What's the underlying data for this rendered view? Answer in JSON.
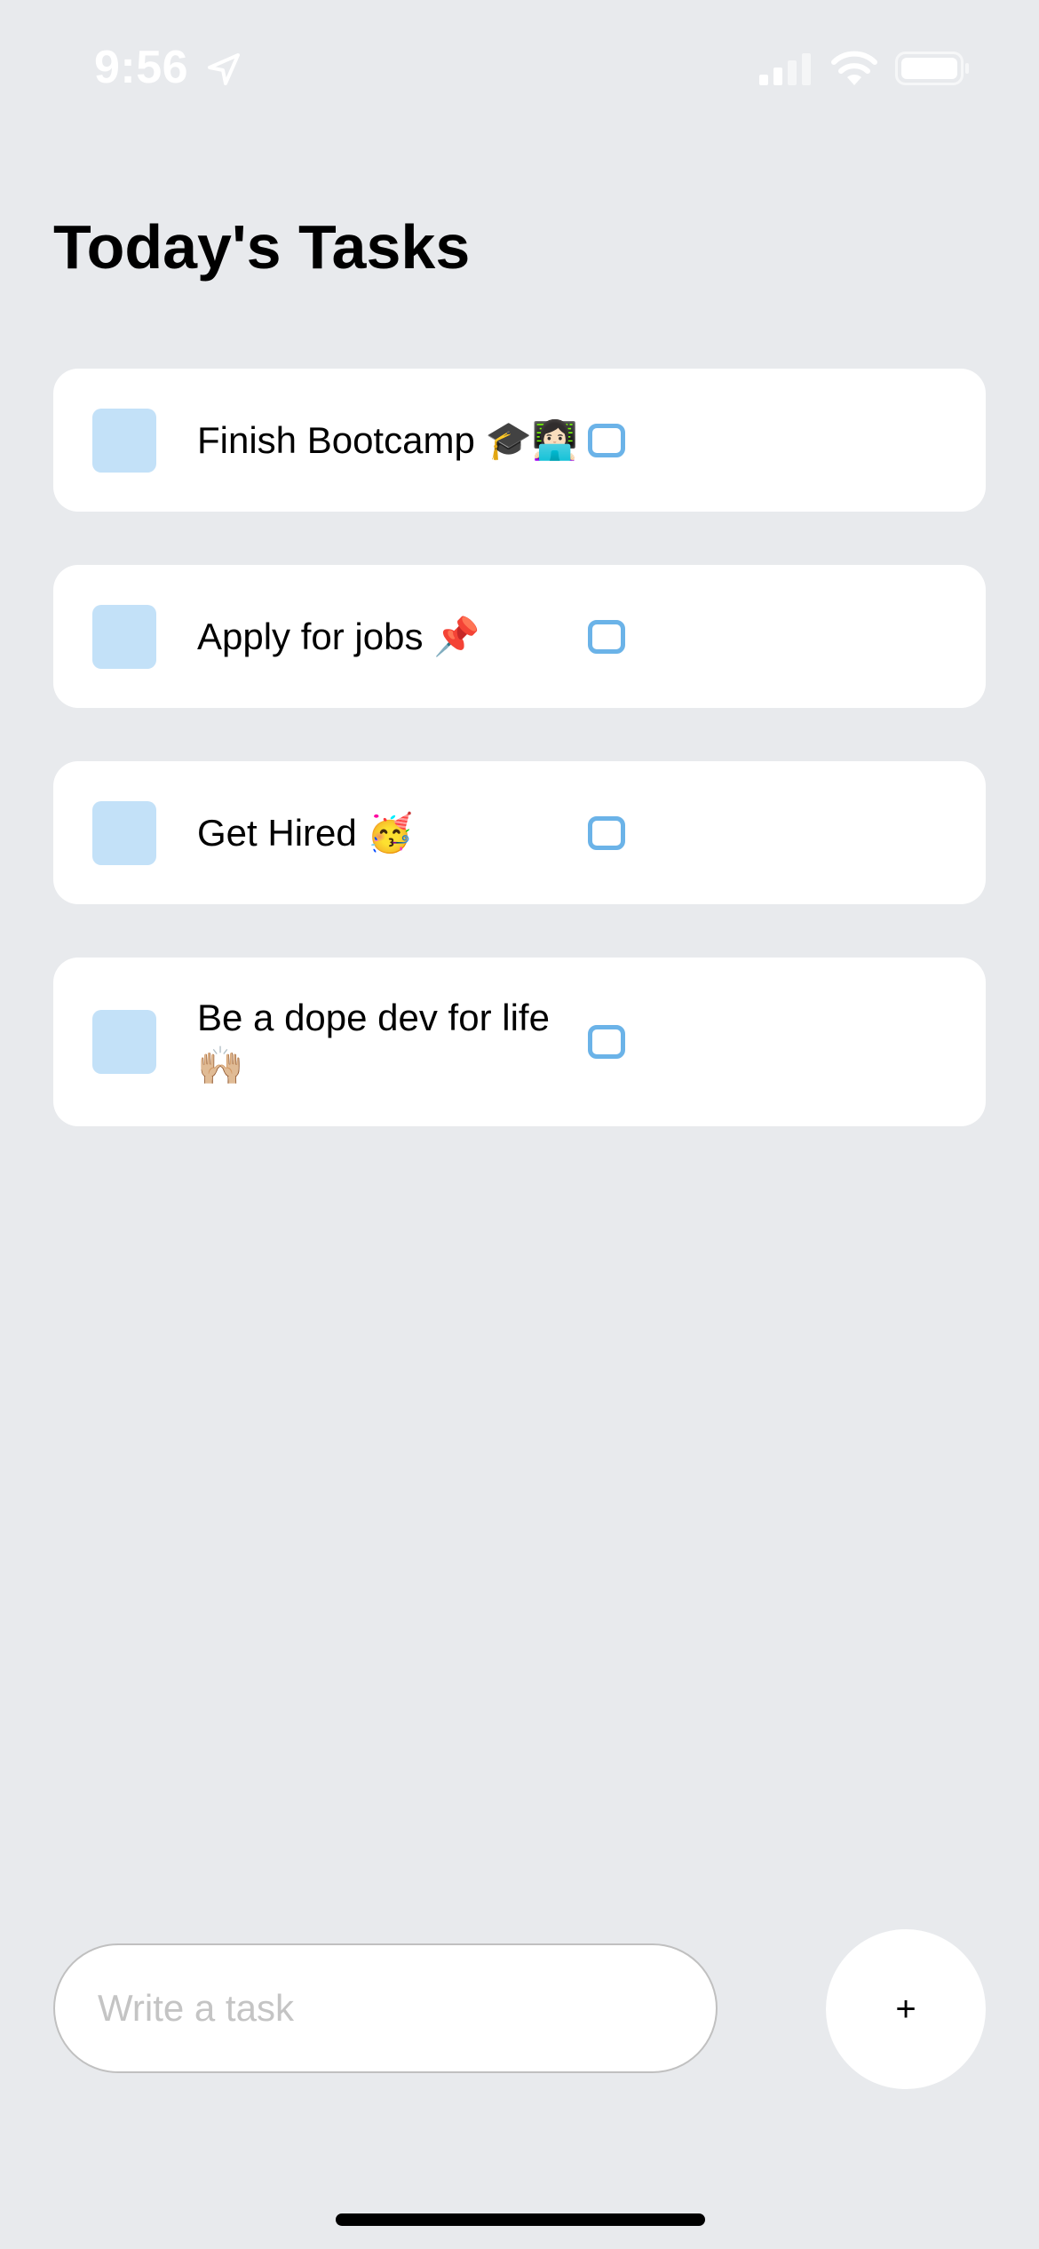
{
  "status_bar": {
    "time": "9:56",
    "icons": [
      "location-arrow-icon",
      "cellular-signal-icon",
      "wifi-icon",
      "battery-icon"
    ]
  },
  "title": "Today's Tasks",
  "tasks": [
    {
      "text": "Finish Bootcamp 🎓👩🏻‍💻"
    },
    {
      "text": "Apply for jobs 📌"
    },
    {
      "text": "Get Hired 🥳"
    },
    {
      "text": "Be a dope dev for life 🙌🏼"
    }
  ],
  "composer": {
    "placeholder": "Write a task",
    "add_label": "+"
  },
  "colors": {
    "background": "#e8eaed",
    "card": "#ffffff",
    "task_square": "#c3e1f8",
    "task_circle": "#6bb3e8"
  }
}
